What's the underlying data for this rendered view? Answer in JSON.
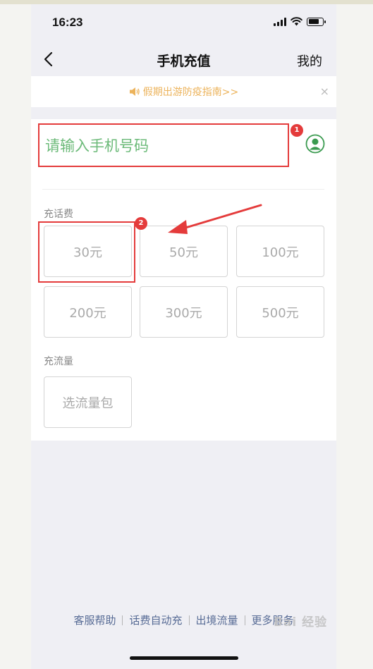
{
  "status_bar": {
    "time": "16:23"
  },
  "nav": {
    "title": "手机充值",
    "right_label": "我的"
  },
  "notice": {
    "text": "假期出游防疫指南>>",
    "close": "×"
  },
  "phone_input": {
    "placeholder": "请输入手机号码"
  },
  "markers": {
    "m1": "1",
    "m2": "2"
  },
  "recharge": {
    "label": "充话费",
    "amounts": [
      "30元",
      "50元",
      "100元",
      "200元",
      "300元",
      "500元"
    ]
  },
  "data_plan": {
    "label": "充流量",
    "button": "选流量包"
  },
  "footer": {
    "links": [
      "客服帮助",
      "话费自动充",
      "出境流量",
      "更多服务"
    ]
  },
  "watermark": "Bai 经验",
  "colors": {
    "accent_green": "#6cba79",
    "notice": "#ecb35b",
    "annotation_red": "#e43b3b",
    "link": "#576b95"
  }
}
